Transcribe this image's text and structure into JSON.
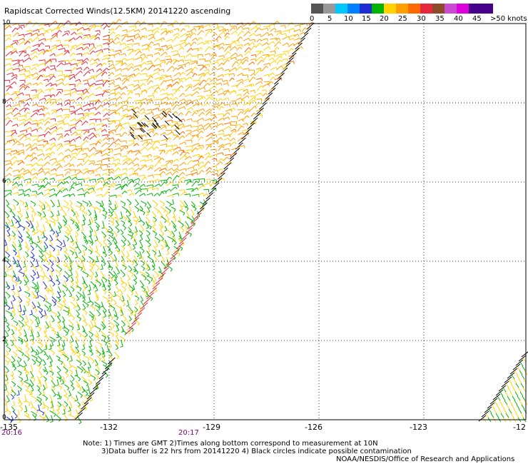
{
  "header": {
    "title": "Rapidscat Corrected Winds(12.5KM) 20141220 ascending"
  },
  "legend": {
    "swatches": [
      {
        "color": "#555555"
      },
      {
        "color": "#999999"
      },
      {
        "color": "#00c8ff"
      },
      {
        "color": "#0080ff"
      },
      {
        "color": "#1e2dd2"
      },
      {
        "color": "#00b400"
      },
      {
        "color": "#ffd200"
      },
      {
        "color": "#ffa000"
      },
      {
        "color": "#ff6a00"
      },
      {
        "color": "#e6283c"
      },
      {
        "color": "#8c4b28"
      },
      {
        "color": "#c84bd2"
      },
      {
        "color": "#dc00dc"
      },
      {
        "color": "#46008c"
      },
      {
        "color": "#46008c"
      }
    ],
    "labels": [
      "0",
      "5",
      "10",
      "15",
      "20",
      "25",
      "30",
      "35",
      "40",
      "45",
      ">50 knots"
    ]
  },
  "map": {
    "lat_labels": [
      "10",
      "8",
      "6",
      "4",
      "2",
      "0"
    ],
    "lon_labels": [
      "-135",
      "-132",
      "-129",
      "-126",
      "-123",
      "-12"
    ],
    "time_labels": [
      "20:16",
      "20:17"
    ]
  },
  "footer": {
    "note_line1": "Note: 1) Times are GMT 2)Times along bottom correspond to measurement at 10N",
    "note_line2": "3)Data buffer is 22 hrs from 20141220 4) Black circles indicate possible contamination",
    "credit": "NOAA/NESDIS/Office of Research and Applications"
  }
}
